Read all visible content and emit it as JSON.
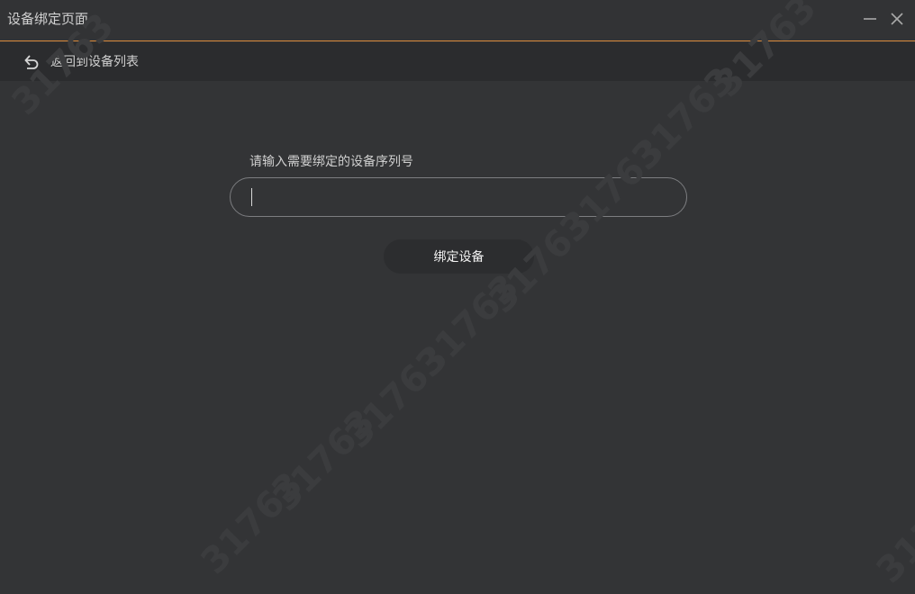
{
  "window": {
    "title": "设备绑定页面"
  },
  "nav": {
    "back_label": "返回到设备列表"
  },
  "form": {
    "label": "请输入需要绑定的设备序列号",
    "serial_value": "",
    "bind_label": "绑定设备"
  },
  "watermark": {
    "text": "31763"
  },
  "colors": {
    "accent": "#d9893a",
    "background": "#333436",
    "nav_background": "#2b2c2e"
  }
}
